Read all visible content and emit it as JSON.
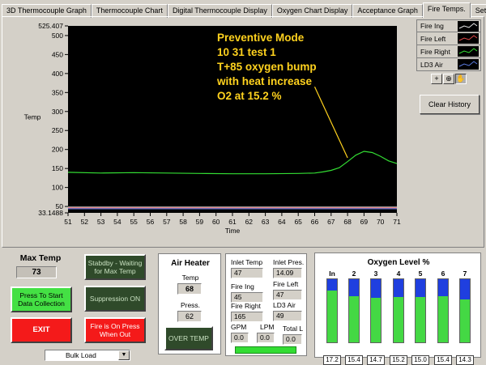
{
  "tabs": [
    {
      "label": "3D Thermocouple Graph",
      "active": false
    },
    {
      "label": "Thermocouple Chart",
      "active": false
    },
    {
      "label": "Digital Thermocouple Display",
      "active": false
    },
    {
      "label": "Oxygen Chart Display",
      "active": false
    },
    {
      "label": "Acceptance Graph",
      "active": false
    },
    {
      "label": "Fire Temps.",
      "active": true
    },
    {
      "label": "Setup",
      "active": false
    }
  ],
  "chart": {
    "title_lines": [
      "Preventive Mode",
      "10 31 test 1",
      "T+85 oxygen bump",
      "with heat increase",
      "O2 at 15.2 %"
    ],
    "title_color": "#ffd21e",
    "ylabel": "Temp",
    "xlabel": "Time"
  },
  "chart_data": {
    "type": "line",
    "xlabel": "Time",
    "ylabel": "Temp",
    "xlim": [
      51,
      71
    ],
    "ylim": [
      33.1488,
      525.407
    ],
    "xticks": [
      51,
      52,
      53,
      54,
      55,
      56,
      57,
      58,
      59,
      60,
      61,
      62,
      63,
      64,
      65,
      66,
      67,
      68,
      69,
      70,
      71
    ],
    "yticks": [
      "33.1488",
      "50",
      "100",
      "150",
      "200",
      "250",
      "300",
      "350",
      "400",
      "450",
      "500",
      "525.407"
    ],
    "grid": false,
    "background": "#000000",
    "series": [
      {
        "name": "Fire Right",
        "color": "#33dd33",
        "x": [
          51,
          53,
          55,
          57,
          59,
          61,
          63,
          65,
          66,
          66.5,
          67,
          67.5,
          68,
          68.5,
          69,
          69.5,
          70,
          70.5,
          71
        ],
        "y": [
          140,
          138,
          139,
          138,
          137,
          136,
          136,
          137,
          138,
          141,
          145,
          152,
          168,
          185,
          195,
          192,
          182,
          170,
          163
        ]
      },
      {
        "name": "Fire Ing",
        "color": "#e8e8e8",
        "x": [
          51,
          56,
          61,
          66,
          71
        ],
        "y": [
          48,
          48,
          48,
          48,
          48
        ]
      },
      {
        "name": "Fire Left",
        "color": "#e04848",
        "x": [
          51,
          56,
          61,
          66,
          71
        ],
        "y": [
          46,
          46,
          46,
          46,
          46
        ]
      },
      {
        "name": "LD3 Air",
        "color": "#5a7adc",
        "x": [
          51,
          56,
          61,
          66,
          71
        ],
        "y": [
          44,
          44,
          44,
          44,
          44
        ]
      }
    ],
    "annotations": [
      {
        "text": "Preventive Mode",
        "x": 62,
        "y": 500
      },
      {
        "text": "10 31 test 1",
        "x": 62,
        "y": 475
      },
      {
        "text": "T+85 oxygen bump",
        "x": 62,
        "y": 450
      },
      {
        "text": "with heat increase",
        "x": 62,
        "y": 425
      },
      {
        "text": "O2 at 15.2 %",
        "x": 62,
        "y": 400
      }
    ],
    "annotation_arrow": {
      "from": [
        66,
        365
      ],
      "to": [
        68,
        178
      ],
      "color": "#ffd21e"
    }
  },
  "legend": {
    "items": [
      {
        "label": "Fire Ing",
        "color": "#e8e8e8"
      },
      {
        "label": "Fire Left",
        "color": "#e04848"
      },
      {
        "label": "Fire Right",
        "color": "#33dd33"
      },
      {
        "label": "LD3 Air",
        "color": "#5a7adc"
      }
    ],
    "tools": [
      "crosshair-tool-icon",
      "zoom-tool-icon",
      "pan-hand-tool-icon"
    ],
    "tool_glyphs": [
      "+",
      "⊕",
      "✋"
    ],
    "clear_label": "Clear History"
  },
  "max_temp": {
    "label": "Max Temp",
    "value": "73"
  },
  "buttons": {
    "start": "Press To Start Data Collection",
    "exit": "EXIT",
    "standby": "Stabdby - Waiting for Max Temp",
    "suppression": "Suppression ON",
    "fire_on": "Fire is On Press When Out"
  },
  "mode_select": {
    "value": "Bulk Load",
    "arrow": "▼"
  },
  "air_heater": {
    "title": "Air Heater",
    "temp_label": "Temp",
    "temp_value": "68",
    "press_label": "Press.",
    "press_value": "62",
    "overtemp_label": "OVER TEMP"
  },
  "inlet": {
    "inlet_temp_label": "Inlet Temp",
    "inlet_temp": "47",
    "inlet_pres_label": "Inlet Pres.",
    "inlet_pres": "14.09",
    "fire_ing_label": "Fire Ing",
    "fire_ing": "45",
    "fire_left_label": "Fire Left",
    "fire_left": "47",
    "fire_right_label": "Fire Right",
    "fire_right": "165",
    "ld3_air_label": "LD3 Air",
    "ld3_air": "49",
    "gpm_label": "GPM",
    "gpm": "0.0",
    "lpm_label": "LPM",
    "lpm": "0.0",
    "total_label": "Total L",
    "total": "0.0"
  },
  "oxygen": {
    "title": "Oxygen Level %",
    "scale_max": 21,
    "columns": [
      {
        "label": "In",
        "value": "17.2",
        "level": 17.2
      },
      {
        "label": "2",
        "value": "15.4",
        "level": 15.4
      },
      {
        "label": "3",
        "value": "14.7",
        "level": 14.7
      },
      {
        "label": "4",
        "value": "15.2",
        "level": 15.2
      },
      {
        "label": "5",
        "value": "15.0",
        "level": 15.0
      },
      {
        "label": "6",
        "value": "15.4",
        "level": 15.4
      },
      {
        "label": "7",
        "value": "14.3",
        "level": 14.3
      }
    ]
  }
}
